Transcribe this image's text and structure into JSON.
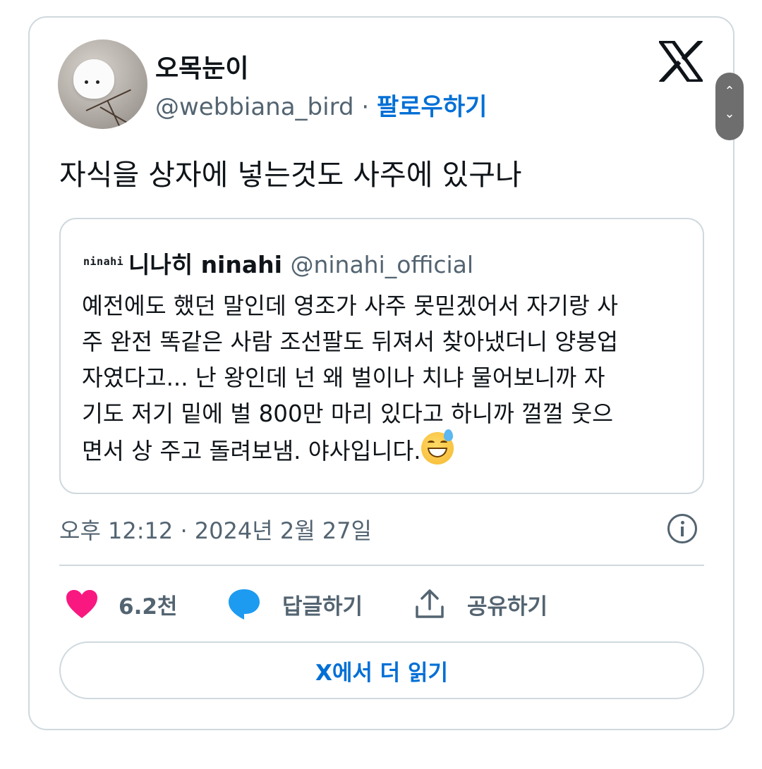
{
  "author": {
    "display_name": "오목눈이",
    "handle": "@webbiana_bird",
    "separator": "·",
    "follow_label": "팔로우하기"
  },
  "tweet": {
    "text": "자식을 상자에 넣는것도 사주에 있구나",
    "timestamp": "오후 12:12 · 2024년 2월 27일"
  },
  "quoted_tweet": {
    "logo_text": "ninahi",
    "display_name": "니나히 ninahi",
    "handle": "@ninahi_official",
    "lines": [
      "예전에도 했던 말인데 영조가 사주 못믿겠어서 자기랑 사",
      "주 완전 똑같은 사람 조선팔도 뒤져서 찾아냈더니 양봉업",
      "자였다고... 난 왕인데 넌 왜 벌이나 치냐 물어보니까 자",
      "기도 저기 밑에 벌 800만 마리 있다고 하니까 껄껄 웃으",
      "면서 상 주고 돌려보냄. 야사입니다."
    ],
    "emoji": "sweat-smile-emoji"
  },
  "actions": {
    "like_count": "6.2천",
    "reply_label": "답글하기",
    "share_label": "공유하기"
  },
  "read_more_label": "X에서 더 읽기",
  "scroll_controls": {
    "up": "⌃",
    "down": "⌄"
  },
  "colors": {
    "link_blue": "#006fd6",
    "like_pink": "#f91880",
    "reply_blue": "#1d9bf0",
    "secondary_text": "#536471",
    "border": "#cfd9de"
  },
  "icons": [
    "x-logo-icon",
    "heart-icon",
    "reply-bubble-icon",
    "share-icon",
    "info-icon"
  ]
}
